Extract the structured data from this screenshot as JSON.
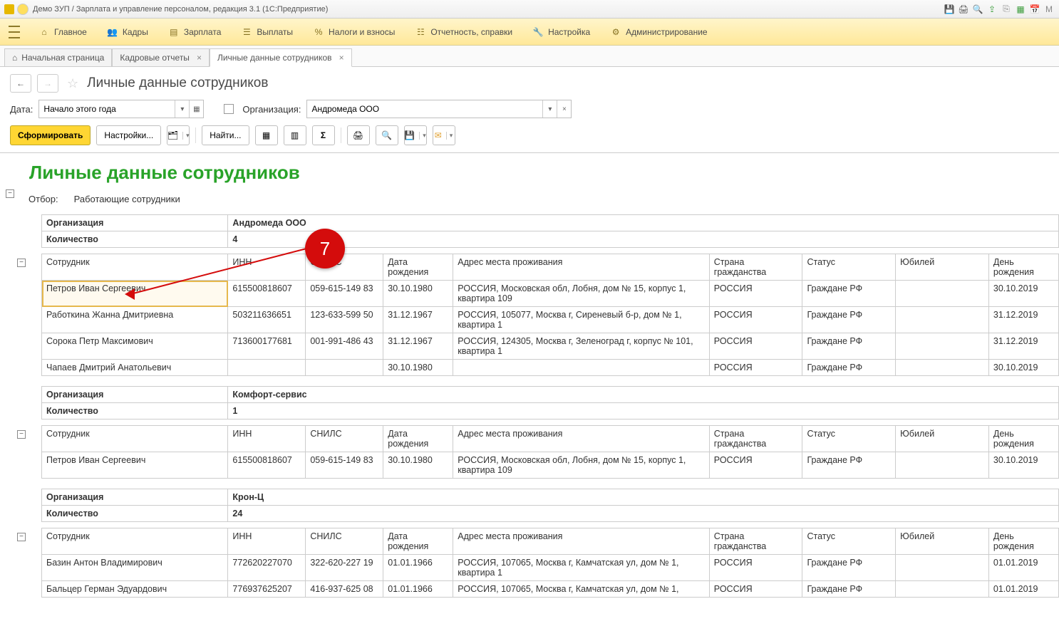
{
  "window": {
    "title": "Демо ЗУП / Зарплата и управление персоналом, редакция 3.1  (1С:Предприятие)"
  },
  "mainmenu": {
    "items": [
      {
        "icon": "menu-icon",
        "label": ""
      },
      {
        "icon": "home-icon",
        "label": "Главное"
      },
      {
        "icon": "people-icon",
        "label": "Кадры"
      },
      {
        "icon": "table-icon",
        "label": "Зарплата"
      },
      {
        "icon": "cash-icon",
        "label": "Выплаты"
      },
      {
        "icon": "percent-icon",
        "label": "Налоги и взносы"
      },
      {
        "icon": "report-icon",
        "label": "Отчетность, справки"
      },
      {
        "icon": "wrench-icon",
        "label": "Настройка"
      },
      {
        "icon": "gear-icon",
        "label": "Администрирование"
      }
    ]
  },
  "tabs": [
    {
      "label": "Начальная страница",
      "closable": false,
      "home": true
    },
    {
      "label": "Кадровые отчеты",
      "closable": true
    },
    {
      "label": "Личные данные сотрудников",
      "closable": true,
      "active": true
    }
  ],
  "page": {
    "title": "Личные данные сотрудников",
    "date_label": "Дата:",
    "date_value": "Начало этого года",
    "org_label": "Организация:",
    "org_value": "Андромеда ООО",
    "btn_generate": "Сформировать",
    "btn_settings": "Настройки...",
    "btn_find": "Найти..."
  },
  "report": {
    "title": "Личные данные сотрудников",
    "filter_label": "Отбор:",
    "filter_value": "Работающие сотрудники",
    "org_header": "Организация",
    "count_header": "Количество",
    "columns": {
      "employee": "Сотрудник",
      "inn": "ИНН",
      "snils": "СНИЛС",
      "dob": "Дата рождения",
      "address": "Адрес места проживания",
      "citizenship": "Страна гражданства",
      "status": "Статус",
      "jubilee": "Юбилей",
      "bday": "День рождения"
    },
    "groups": [
      {
        "org": "Андромеда ООО",
        "count": "4",
        "rows": [
          {
            "emp": "Петров Иван Сергеевич",
            "inn": "615500818607",
            "snils": "059-615-149 83",
            "dob": "30.10.1980",
            "addr": "РОССИЯ, Московская обл, Лобня, дом № 15, корпус 1, квартира 109",
            "ctz": "РОССИЯ",
            "status": "Граждане РФ",
            "jub": "",
            "bday": "30.10.2019",
            "selected": true
          },
          {
            "emp": "Работкина Жанна Дмитриевна",
            "inn": "503211636651",
            "snils": "123-633-599 50",
            "dob": "31.12.1967",
            "addr": "РОССИЯ, 105077, Москва г, Сиреневый б-р, дом № 1, квартира 1",
            "ctz": "РОССИЯ",
            "status": "Граждане РФ",
            "jub": "",
            "bday": "31.12.2019"
          },
          {
            "emp": "Сорока Петр Максимович",
            "inn": "713600177681",
            "snils": "001-991-486 43",
            "dob": "31.12.1967",
            "addr": "РОССИЯ, 124305, Москва г, Зеленоград г, корпус № 101, квартира 1",
            "ctz": "РОССИЯ",
            "status": "Граждане РФ",
            "jub": "",
            "bday": "31.12.2019"
          },
          {
            "emp": "Чапаев Дмитрий Анатольевич",
            "inn": "",
            "snils": "",
            "dob": "30.10.1980",
            "addr": "",
            "ctz": "РОССИЯ",
            "status": "Граждане РФ",
            "jub": "",
            "bday": "30.10.2019"
          }
        ]
      },
      {
        "org": "Комфорт-сервис",
        "count": "1",
        "rows": [
          {
            "emp": "Петров Иван Сергеевич",
            "inn": "615500818607",
            "snils": "059-615-149 83",
            "dob": "30.10.1980",
            "addr": "РОССИЯ, Московская обл, Лобня, дом № 15, корпус 1, квартира 109",
            "ctz": "РОССИЯ",
            "status": "Граждане РФ",
            "jub": "",
            "bday": "30.10.2019"
          }
        ]
      },
      {
        "org": "Крон-Ц",
        "count": "24",
        "rows": [
          {
            "emp": "Базин Антон Владимирович",
            "inn": "772620227070",
            "snils": "322-620-227 19",
            "dob": "01.01.1966",
            "addr": "РОССИЯ, 107065, Москва г, Камчатская ул, дом № 1, квартира 1",
            "ctz": "РОССИЯ",
            "status": "Граждане РФ",
            "jub": "",
            "bday": "01.01.2019"
          },
          {
            "emp": "Бальцер Герман Эдуардович",
            "inn": "776937625207",
            "snils": "416-937-625 08",
            "dob": "01.01.1966",
            "addr": "РОССИЯ, 107065, Москва г, Камчатская ул, дом № 1,",
            "ctz": "РОССИЯ",
            "status": "Граждане РФ",
            "jub": "",
            "bday": "01.01.2019"
          }
        ]
      }
    ]
  },
  "annotation": {
    "number": "7"
  }
}
